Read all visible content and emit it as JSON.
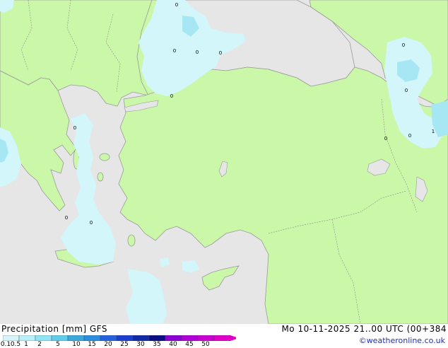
{
  "header": {
    "left_title": "Precipitation [mm]  GFS",
    "right_title": "Mo 10-11-2025 21..00 UTC (00+384",
    "credit": "©weatheronline.co.uk"
  },
  "legend": {
    "ticks": [
      "0.1",
      "0.5",
      "1",
      "2",
      "5",
      "10",
      "15",
      "20",
      "25",
      "30",
      "35",
      "40",
      "45",
      "50"
    ],
    "colors": [
      "#d6f5fa",
      "#b9effa",
      "#8fe4f5",
      "#5fcdea",
      "#3aa8dd",
      "#2c8ce0",
      "#2461dd",
      "#1a3fcf",
      "#102aa6",
      "#090e82",
      "#8a00d5",
      "#b000d8",
      "#cc00d2",
      "#e000c8"
    ]
  },
  "map": {
    "sea_color": "#e6e6e6",
    "land_color": "#caf8a8",
    "light_precip_color": "#d2f6fa",
    "medium_precip_color": "#a7e6f3",
    "station_values": [
      "0",
      "0",
      "0",
      "0",
      "0",
      "0",
      "0",
      "0",
      "0",
      "0",
      "0",
      "0",
      "1"
    ]
  }
}
